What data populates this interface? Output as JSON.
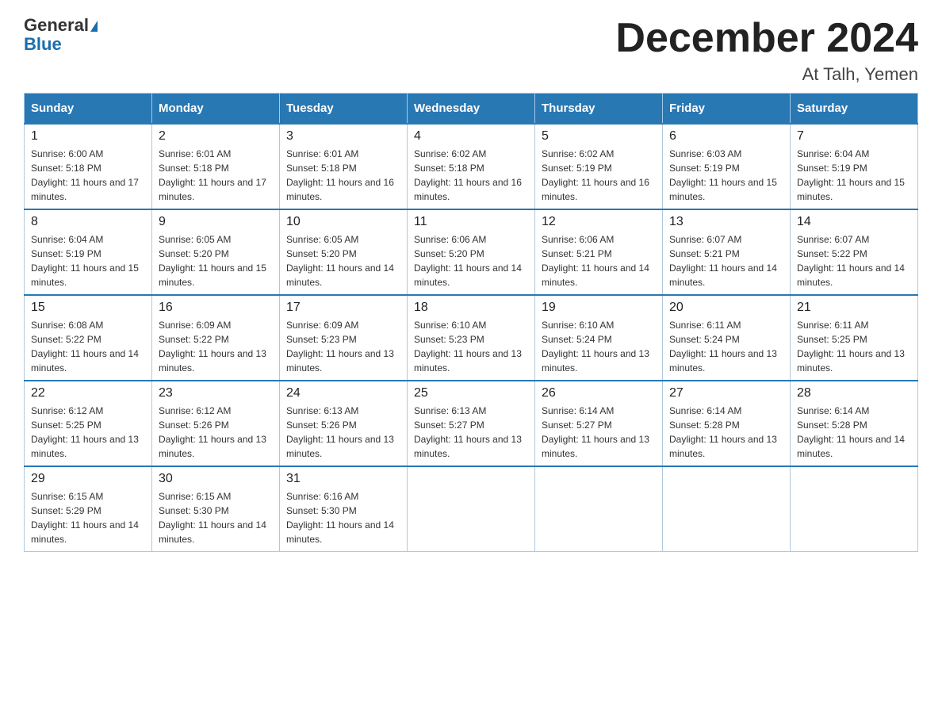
{
  "logo": {
    "general": "General",
    "blue": "Blue"
  },
  "title": "December 2024",
  "subtitle": "At Talh, Yemen",
  "days_of_week": [
    "Sunday",
    "Monday",
    "Tuesday",
    "Wednesday",
    "Thursday",
    "Friday",
    "Saturday"
  ],
  "weeks": [
    [
      {
        "day": "1",
        "sunrise": "6:00 AM",
        "sunset": "5:18 PM",
        "daylight": "11 hours and 17 minutes."
      },
      {
        "day": "2",
        "sunrise": "6:01 AM",
        "sunset": "5:18 PM",
        "daylight": "11 hours and 17 minutes."
      },
      {
        "day": "3",
        "sunrise": "6:01 AM",
        "sunset": "5:18 PM",
        "daylight": "11 hours and 16 minutes."
      },
      {
        "day": "4",
        "sunrise": "6:02 AM",
        "sunset": "5:18 PM",
        "daylight": "11 hours and 16 minutes."
      },
      {
        "day": "5",
        "sunrise": "6:02 AM",
        "sunset": "5:19 PM",
        "daylight": "11 hours and 16 minutes."
      },
      {
        "day": "6",
        "sunrise": "6:03 AM",
        "sunset": "5:19 PM",
        "daylight": "11 hours and 15 minutes."
      },
      {
        "day": "7",
        "sunrise": "6:04 AM",
        "sunset": "5:19 PM",
        "daylight": "11 hours and 15 minutes."
      }
    ],
    [
      {
        "day": "8",
        "sunrise": "6:04 AM",
        "sunset": "5:19 PM",
        "daylight": "11 hours and 15 minutes."
      },
      {
        "day": "9",
        "sunrise": "6:05 AM",
        "sunset": "5:20 PM",
        "daylight": "11 hours and 15 minutes."
      },
      {
        "day": "10",
        "sunrise": "6:05 AM",
        "sunset": "5:20 PM",
        "daylight": "11 hours and 14 minutes."
      },
      {
        "day": "11",
        "sunrise": "6:06 AM",
        "sunset": "5:20 PM",
        "daylight": "11 hours and 14 minutes."
      },
      {
        "day": "12",
        "sunrise": "6:06 AM",
        "sunset": "5:21 PM",
        "daylight": "11 hours and 14 minutes."
      },
      {
        "day": "13",
        "sunrise": "6:07 AM",
        "sunset": "5:21 PM",
        "daylight": "11 hours and 14 minutes."
      },
      {
        "day": "14",
        "sunrise": "6:07 AM",
        "sunset": "5:22 PM",
        "daylight": "11 hours and 14 minutes."
      }
    ],
    [
      {
        "day": "15",
        "sunrise": "6:08 AM",
        "sunset": "5:22 PM",
        "daylight": "11 hours and 14 minutes."
      },
      {
        "day": "16",
        "sunrise": "6:09 AM",
        "sunset": "5:22 PM",
        "daylight": "11 hours and 13 minutes."
      },
      {
        "day": "17",
        "sunrise": "6:09 AM",
        "sunset": "5:23 PM",
        "daylight": "11 hours and 13 minutes."
      },
      {
        "day": "18",
        "sunrise": "6:10 AM",
        "sunset": "5:23 PM",
        "daylight": "11 hours and 13 minutes."
      },
      {
        "day": "19",
        "sunrise": "6:10 AM",
        "sunset": "5:24 PM",
        "daylight": "11 hours and 13 minutes."
      },
      {
        "day": "20",
        "sunrise": "6:11 AM",
        "sunset": "5:24 PM",
        "daylight": "11 hours and 13 minutes."
      },
      {
        "day": "21",
        "sunrise": "6:11 AM",
        "sunset": "5:25 PM",
        "daylight": "11 hours and 13 minutes."
      }
    ],
    [
      {
        "day": "22",
        "sunrise": "6:12 AM",
        "sunset": "5:25 PM",
        "daylight": "11 hours and 13 minutes."
      },
      {
        "day": "23",
        "sunrise": "6:12 AM",
        "sunset": "5:26 PM",
        "daylight": "11 hours and 13 minutes."
      },
      {
        "day": "24",
        "sunrise": "6:13 AM",
        "sunset": "5:26 PM",
        "daylight": "11 hours and 13 minutes."
      },
      {
        "day": "25",
        "sunrise": "6:13 AM",
        "sunset": "5:27 PM",
        "daylight": "11 hours and 13 minutes."
      },
      {
        "day": "26",
        "sunrise": "6:14 AM",
        "sunset": "5:27 PM",
        "daylight": "11 hours and 13 minutes."
      },
      {
        "day": "27",
        "sunrise": "6:14 AM",
        "sunset": "5:28 PM",
        "daylight": "11 hours and 13 minutes."
      },
      {
        "day": "28",
        "sunrise": "6:14 AM",
        "sunset": "5:28 PM",
        "daylight": "11 hours and 14 minutes."
      }
    ],
    [
      {
        "day": "29",
        "sunrise": "6:15 AM",
        "sunset": "5:29 PM",
        "daylight": "11 hours and 14 minutes."
      },
      {
        "day": "30",
        "sunrise": "6:15 AM",
        "sunset": "5:30 PM",
        "daylight": "11 hours and 14 minutes."
      },
      {
        "day": "31",
        "sunrise": "6:16 AM",
        "sunset": "5:30 PM",
        "daylight": "11 hours and 14 minutes."
      },
      null,
      null,
      null,
      null
    ]
  ]
}
